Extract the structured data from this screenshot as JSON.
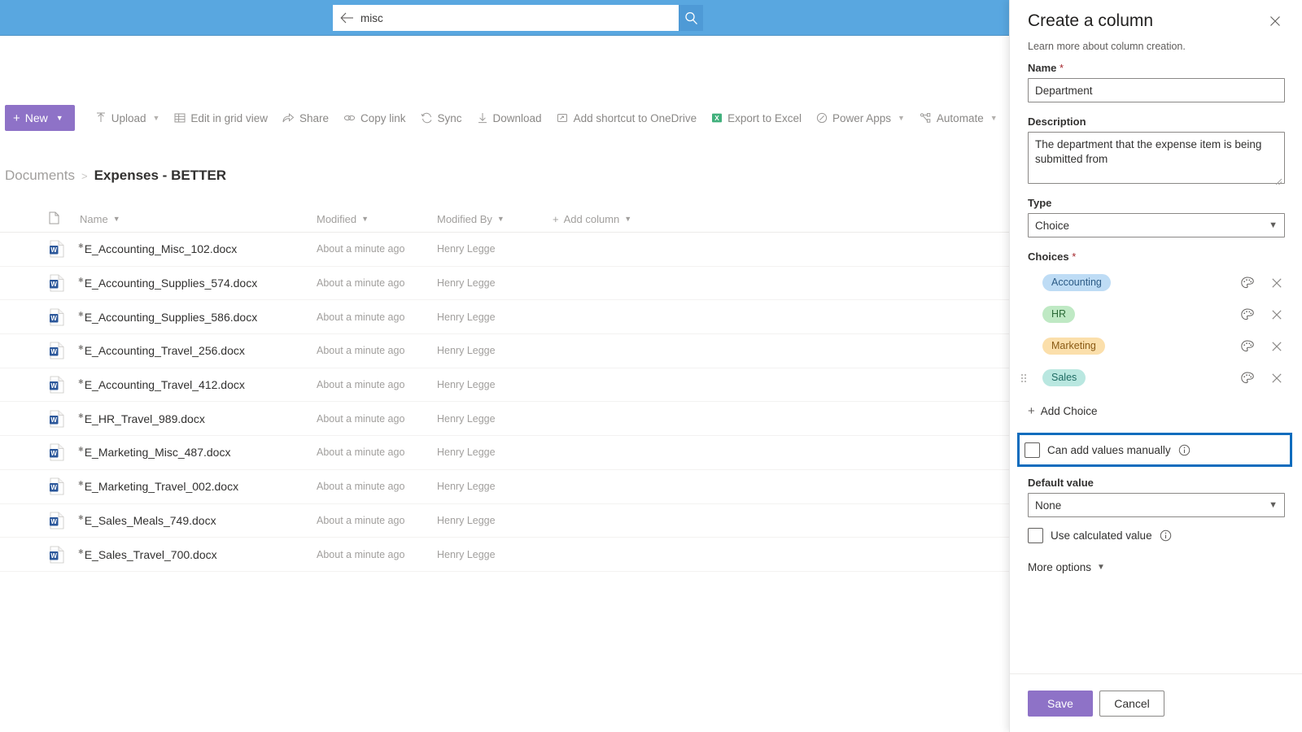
{
  "search": {
    "value": "misc",
    "back_icon": "back-arrow-icon",
    "search_icon": "search-icon"
  },
  "commandbar": {
    "new_label": "New",
    "items": [
      {
        "label": "Upload",
        "icon": "upload-icon",
        "has_chevron": true
      },
      {
        "label": "Edit in grid view",
        "icon": "grid-icon",
        "has_chevron": false
      },
      {
        "label": "Share",
        "icon": "share-icon",
        "has_chevron": false
      },
      {
        "label": "Copy link",
        "icon": "link-icon",
        "has_chevron": false
      },
      {
        "label": "Sync",
        "icon": "sync-icon",
        "has_chevron": false
      },
      {
        "label": "Download",
        "icon": "download-icon",
        "has_chevron": false
      },
      {
        "label": "Add shortcut to OneDrive",
        "icon": "onedrive-shortcut-icon",
        "has_chevron": false
      },
      {
        "label": "Export to Excel",
        "icon": "excel-icon",
        "has_chevron": false
      },
      {
        "label": "Power Apps",
        "icon": "powerapps-icon",
        "has_chevron": true
      },
      {
        "label": "Automate",
        "icon": "automate-icon",
        "has_chevron": true
      }
    ]
  },
  "breadcrumb": {
    "root": "Documents",
    "separator": ">",
    "current": "Expenses - BETTER"
  },
  "list": {
    "columns": [
      "Name",
      "Modified",
      "Modified By"
    ],
    "add_column_label": "Add column",
    "rows": [
      {
        "name": "E_Accounting_Misc_102.docx",
        "modified": "About a minute ago",
        "modified_by": "Henry Legge"
      },
      {
        "name": "E_Accounting_Supplies_574.docx",
        "modified": "About a minute ago",
        "modified_by": "Henry Legge"
      },
      {
        "name": "E_Accounting_Supplies_586.docx",
        "modified": "About a minute ago",
        "modified_by": "Henry Legge"
      },
      {
        "name": "E_Accounting_Travel_256.docx",
        "modified": "About a minute ago",
        "modified_by": "Henry Legge"
      },
      {
        "name": "E_Accounting_Travel_412.docx",
        "modified": "About a minute ago",
        "modified_by": "Henry Legge"
      },
      {
        "name": "E_HR_Travel_989.docx",
        "modified": "About a minute ago",
        "modified_by": "Henry Legge"
      },
      {
        "name": "E_Marketing_Misc_487.docx",
        "modified": "About a minute ago",
        "modified_by": "Henry Legge"
      },
      {
        "name": "E_Marketing_Travel_002.docx",
        "modified": "About a minute ago",
        "modified_by": "Henry Legge"
      },
      {
        "name": "E_Sales_Meals_749.docx",
        "modified": "About a minute ago",
        "modified_by": "Henry Legge"
      },
      {
        "name": "E_Sales_Travel_700.docx",
        "modified": "About a minute ago",
        "modified_by": "Henry Legge"
      }
    ]
  },
  "panel": {
    "title": "Create a column",
    "subtitle": "Learn more about column creation.",
    "close_icon": "close-icon",
    "name": {
      "label": "Name",
      "required": "*",
      "value": "Department"
    },
    "description": {
      "label": "Description",
      "value": "The department that the expense item is being submitted from"
    },
    "type": {
      "label": "Type",
      "value": "Choice"
    },
    "choices": {
      "label": "Choices",
      "required": "*",
      "items": [
        {
          "label": "Accounting",
          "bg": "#bedcf5",
          "fg": "#2b5a85"
        },
        {
          "label": "HR",
          "bg": "#bfe9c4",
          "fg": "#2c6b38"
        },
        {
          "label": "Marketing",
          "bg": "#fbdfab",
          "fg": "#8a5a14"
        },
        {
          "label": "Sales",
          "bg": "#b9e7e0",
          "fg": "#1f6b63"
        }
      ],
      "add_label": "Add Choice",
      "palette_icon": "palette-icon",
      "remove_icon": "close-icon",
      "drag_icon": "drag-handle-icon"
    },
    "can_add_manually": {
      "label": "Can add values manually",
      "checked": false,
      "info_icon": "info-icon",
      "highlight_color": "#0f6cbd"
    },
    "default_value": {
      "label": "Default value",
      "value": "None"
    },
    "use_calculated": {
      "label": "Use calculated value",
      "checked": false,
      "info_icon": "info-icon"
    },
    "more_options": "More options",
    "save_label": "Save",
    "cancel_label": "Cancel"
  },
  "colors": {
    "search_band": "#59a7e0",
    "accent_purple": "#8e72c7",
    "highlight_blue": "#0f6cbd",
    "excel_green": "#21a366"
  }
}
